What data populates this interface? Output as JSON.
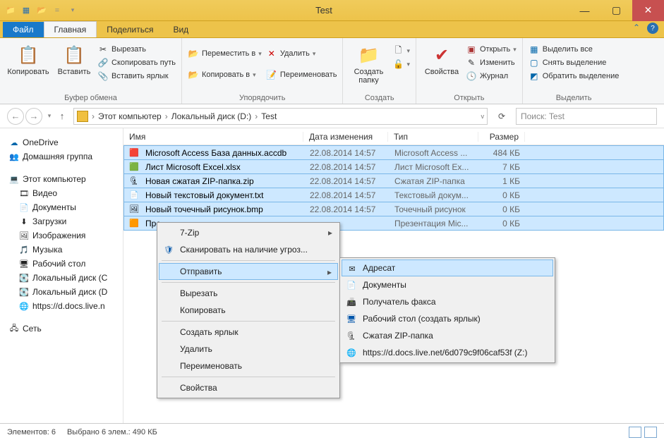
{
  "window": {
    "title": "Test",
    "min": "—",
    "max": "▢",
    "close": "✕"
  },
  "tabs": {
    "file": "Файл",
    "home": "Главная",
    "share": "Поделиться",
    "view": "Вид"
  },
  "ribbon": {
    "clipboard": {
      "copy": "Копировать",
      "paste": "Вставить",
      "cut": "Вырезать",
      "copypath": "Скопировать путь",
      "pastelink": "Вставить ярлык",
      "label": "Буфер обмена"
    },
    "organize": {
      "moveto": "Переместить в",
      "copyto": "Копировать в",
      "delete": "Удалить",
      "rename": "Переименовать",
      "label": "Упорядочить"
    },
    "new": {
      "newfolder": "Создать папку",
      "label": "Создать"
    },
    "open": {
      "properties": "Свойства",
      "open": "Открыть",
      "edit": "Изменить",
      "history": "Журнал",
      "label": "Открыть"
    },
    "select": {
      "selectall": "Выделить все",
      "selectnone": "Снять выделение",
      "invert": "Обратить выделение",
      "label": "Выделить"
    }
  },
  "breadcrumb": {
    "pc": "Этот компьютер",
    "drive": "Локальный диск (D:)",
    "folder": "Test"
  },
  "search": {
    "placeholder": "Поиск: Test"
  },
  "nav": {
    "onedrive": "OneDrive",
    "homegroup": "Домашняя группа",
    "thispc": "Этот компьютер",
    "videos": "Видео",
    "documents": "Документы",
    "downloads": "Загрузки",
    "pictures": "Изображения",
    "music": "Музыка",
    "desktop": "Рабочий стол",
    "driveC": "Локальный диск (C",
    "driveD": "Локальный диск (D",
    "netdrive": "https://d.docs.live.n",
    "network": "Сеть"
  },
  "columns": {
    "name": "Имя",
    "date": "Дата изменения",
    "type": "Тип",
    "size": "Размер"
  },
  "files": [
    {
      "name": "Microsoft Access База данных.accdb",
      "date": "22.08.2014 14:57",
      "type": "Microsoft Access ...",
      "size": "484 КБ"
    },
    {
      "name": "Лист Microsoft Excel.xlsx",
      "date": "22.08.2014 14:57",
      "type": "Лист Microsoft Ex...",
      "size": "7 КБ"
    },
    {
      "name": "Новая сжатая ZIP-папка.zip",
      "date": "22.08.2014 14:57",
      "type": "Сжатая ZIP-папка",
      "size": "1 КБ"
    },
    {
      "name": "Новый текстовый документ.txt",
      "date": "22.08.2014 14:57",
      "type": "Текстовый докум...",
      "size": "0 КБ"
    },
    {
      "name": "Новый точечный рисунок.bmp",
      "date": "22.08.2014 14:57",
      "type": "Точечный рисунок",
      "size": "0 КБ"
    },
    {
      "name": "Пре",
      "date": "",
      "type": "Презентация Mic...",
      "size": "0 КБ"
    }
  ],
  "contextmenu": {
    "sevenzip": "7-Zip",
    "scan": "Сканировать на наличие угроз...",
    "sendto": "Отправить",
    "cut": "Вырезать",
    "copy": "Копировать",
    "shortcut": "Создать ярлык",
    "delete": "Удалить",
    "rename": "Переименовать",
    "properties": "Свойства"
  },
  "sendtomenu": {
    "recipient": "Адресат",
    "documents": "Документы",
    "fax": "Получатель факса",
    "desktop": "Рабочий стол (создать ярлык)",
    "zip": "Сжатая ZIP-папка",
    "netpath": "https://d.docs.live.net/6d079c9f06caf53f (Z:)"
  },
  "status": {
    "count": "Элементов: 6",
    "selected": "Выбрано 6 элем.: 490 КБ"
  }
}
